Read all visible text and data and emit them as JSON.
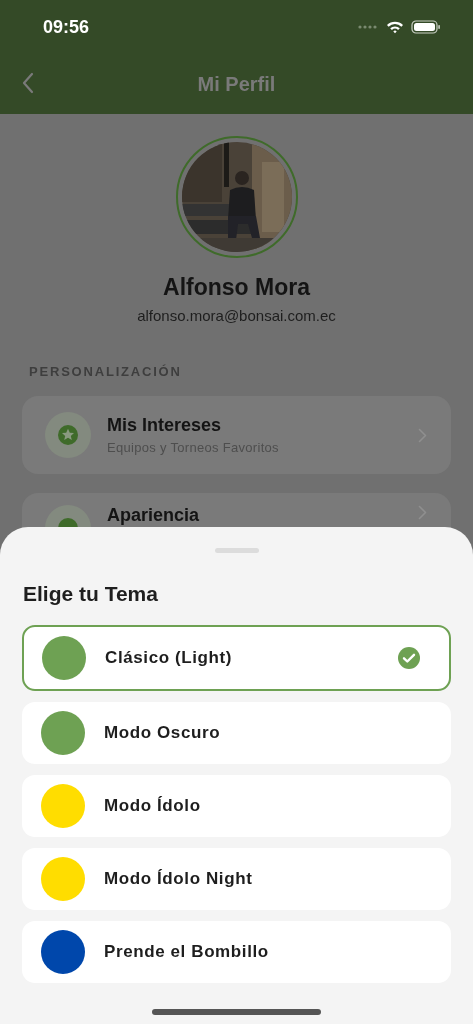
{
  "status_bar": {
    "time": "09:56"
  },
  "nav": {
    "title": "Mi Perfil"
  },
  "profile": {
    "name": "Alfonso Mora",
    "email": "alfonso.mora@bonsai.com.ec"
  },
  "section": {
    "title": "PERSONALIZACIÓN",
    "items": [
      {
        "title": "Mis Intereses",
        "subtitle": "Equipos y Torneos Favoritos"
      },
      {
        "title": "Apariencia"
      }
    ]
  },
  "sheet": {
    "title": "Elige tu Tema",
    "options": [
      {
        "label": "Clásico (Light)",
        "color": "#6ea153",
        "selected": true
      },
      {
        "label": "Modo Oscuro",
        "color": "#6ea153",
        "selected": false
      },
      {
        "label": "Modo Ídolo",
        "color": "#ffdd00",
        "selected": false
      },
      {
        "label": "Modo Ídolo Night",
        "color": "#ffdd00",
        "selected": false
      },
      {
        "label": "Prende el Bombillo",
        "color": "#0047ab",
        "selected": false
      }
    ]
  }
}
